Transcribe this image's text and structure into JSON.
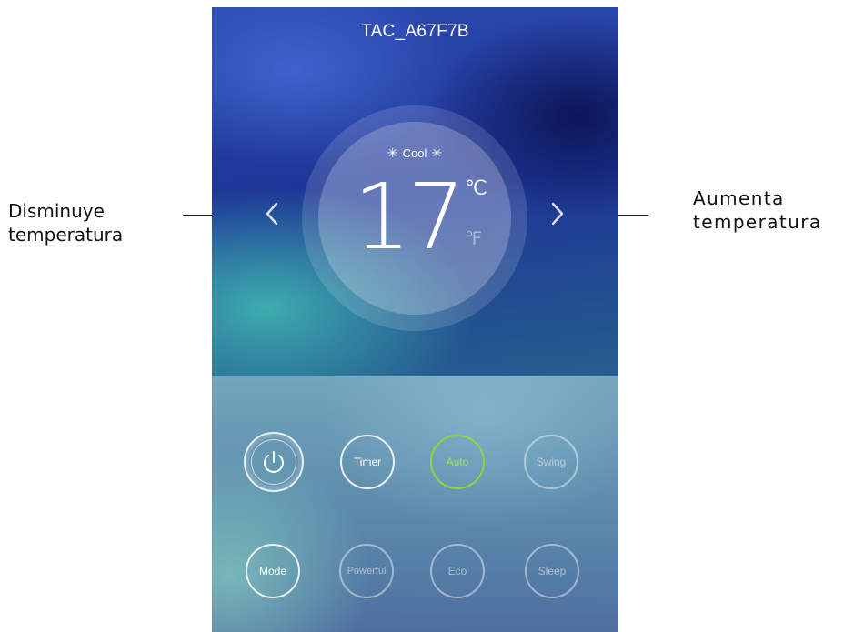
{
  "device": {
    "name": "TAC_A67F7B"
  },
  "thermostat": {
    "mode_label": "Cool",
    "mode_icon": "snowflake-icon",
    "temperature": "17",
    "unit_celsius": "℃",
    "unit_fahrenheit": "℉",
    "decrease_icon": "chevron-left-icon",
    "increase_icon": "chevron-right-icon"
  },
  "annotations": {
    "left_line1": "Disminuye",
    "left_line2": "temperatura",
    "right_line1": "Aumenta",
    "right_line2": "temperatura"
  },
  "controls": {
    "row1": [
      {
        "label": "",
        "icon": "power-icon"
      },
      {
        "label": "Timer"
      },
      {
        "label": "Auto",
        "active": true,
        "color": "#8fd63a"
      },
      {
        "label": "Swing",
        "enabled": false
      }
    ],
    "row2": [
      {
        "label": "Mode"
      },
      {
        "label": "Powerful",
        "enabled": false
      },
      {
        "label": "Eco",
        "enabled": false
      },
      {
        "label": "Sleep",
        "enabled": false
      }
    ]
  },
  "colors": {
    "accent_active": "#8fd63a",
    "text": "#ffffff"
  }
}
